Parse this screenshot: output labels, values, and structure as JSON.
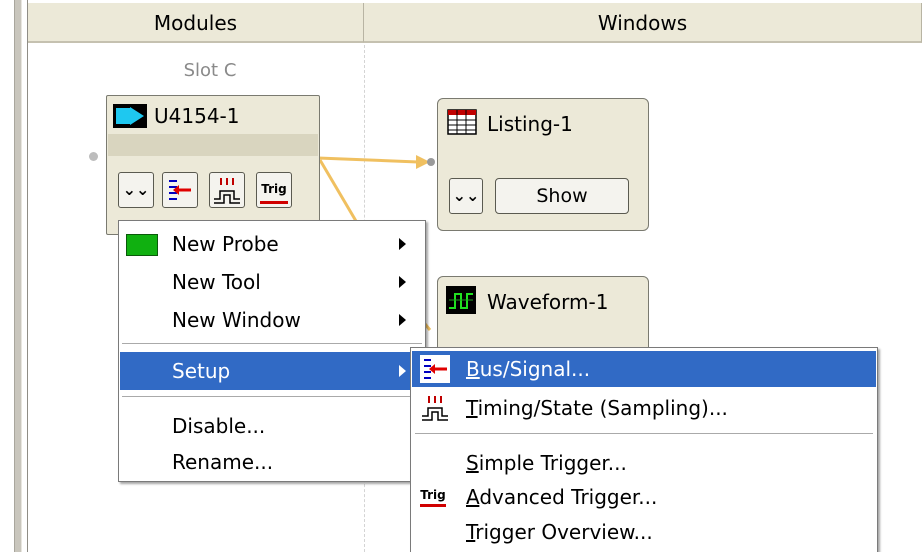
{
  "columns": {
    "modules": "Modules",
    "windows": "Windows"
  },
  "slot_label": "Slot C",
  "module": {
    "title": "U4154-1",
    "trig_label": "Trig"
  },
  "listing": {
    "title": "Listing-1",
    "show_label": "Show"
  },
  "waveform": {
    "title": "Waveform-1"
  },
  "context_menu": {
    "items": [
      {
        "label": "New Probe",
        "submenu": true
      },
      {
        "label": "New Tool",
        "submenu": true
      },
      {
        "label": "New Window",
        "submenu": true
      },
      {
        "label": "Setup",
        "submenu": true,
        "highlighted": true
      },
      {
        "label": "Disable..."
      },
      {
        "label": "Rename..."
      }
    ]
  },
  "setup_submenu": {
    "items": [
      {
        "mnemonic": "B",
        "rest": "us/Signal...",
        "highlighted": true
      },
      {
        "mnemonic": "T",
        "rest": "iming/State (Sampling)..."
      },
      {
        "mnemonic": "S",
        "rest": "imple Trigger..."
      },
      {
        "mnemonic": "A",
        "rest": "dvanced Trigger..."
      },
      {
        "mnemonic": "T",
        "rest": "rigger Overview..."
      }
    ],
    "trig_icon_label": "Trig"
  },
  "colors": {
    "highlight": "#316ac5",
    "panel": "#ece9d8",
    "connector": "#f0c060"
  }
}
